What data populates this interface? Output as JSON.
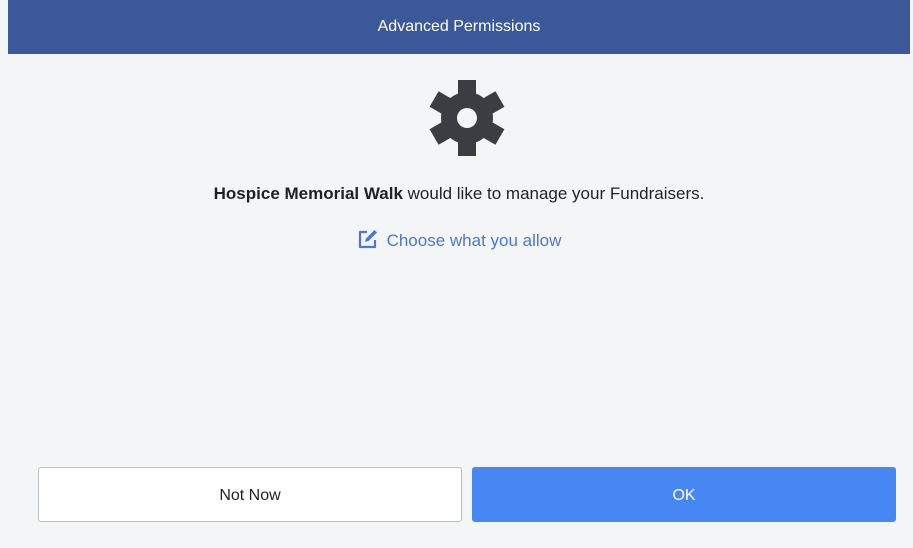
{
  "dialog": {
    "title": "Advanced Permissions",
    "icon": "gear-icon",
    "message": {
      "app_name": "Hospice Memorial Walk",
      "text": " would like to manage your Fundraisers."
    },
    "choose_link": {
      "icon": "edit-icon",
      "label": "Choose what you allow"
    },
    "buttons": {
      "not_now": "Not Now",
      "ok": "OK"
    }
  },
  "colors": {
    "title_bar": "#3b5998",
    "link": "#4a78d8",
    "primary_button": "#4687f4",
    "background": "#f4f5f7",
    "gear": "#3a3d42"
  }
}
